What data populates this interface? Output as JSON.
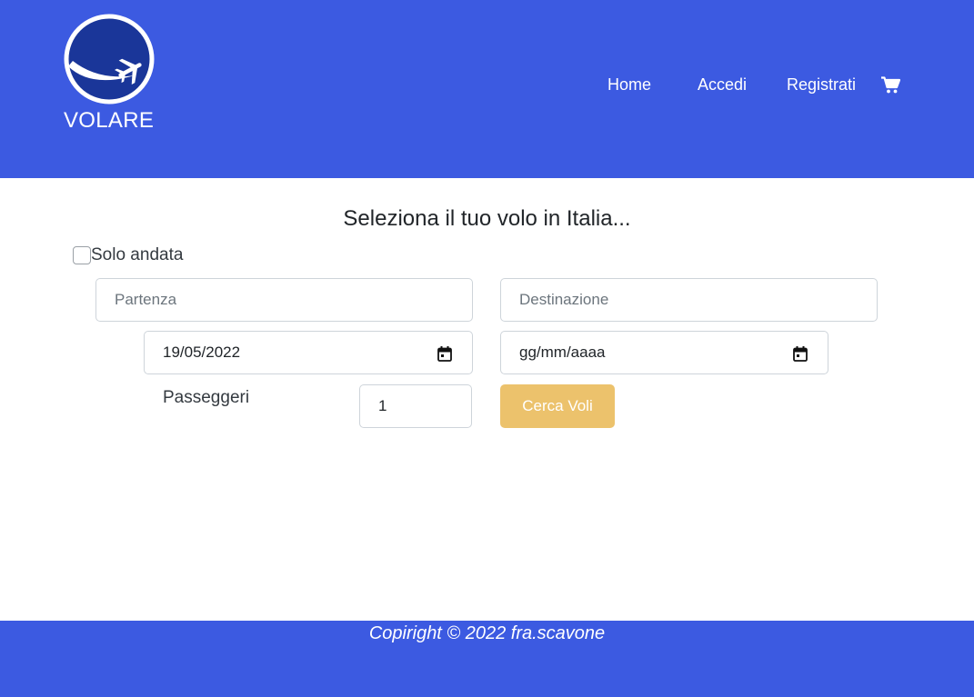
{
  "header": {
    "brand": "VOLARE",
    "logo_icon": "airplane-globe-icon",
    "nav": {
      "home": "Home",
      "login": "Accedi",
      "register": "Registrati"
    },
    "cart_icon": "shopping-cart-icon"
  },
  "main": {
    "heading": "Seleziona il tuo volo in Italia...",
    "one_way": {
      "label": "Solo andata",
      "checked": false
    },
    "departure": {
      "placeholder": "Partenza",
      "value": ""
    },
    "destination": {
      "placeholder": "Destinazione",
      "value": ""
    },
    "departure_date": {
      "value": "19/05/2022"
    },
    "return_date": {
      "value": "gg/mm/aaaa"
    },
    "passengers": {
      "label": "Passeggeri",
      "value": "1"
    },
    "search_button": "Cerca Voli"
  },
  "footer": {
    "copyright": "Copiright © 2022 fra.scavone"
  },
  "colors": {
    "primary": "#3c5ae1",
    "button": "#ecc26c",
    "logo_circle": "#1a3699"
  }
}
